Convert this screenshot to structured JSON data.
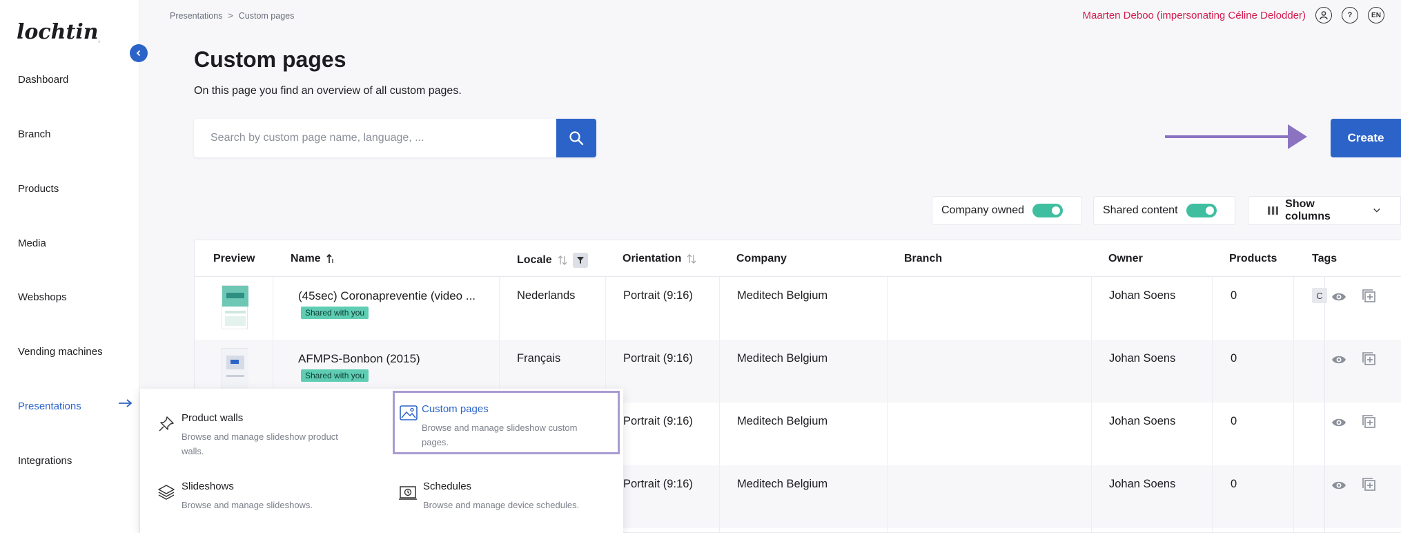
{
  "brand": {
    "logo_text": "lochting",
    "primary": "#2c63c8",
    "alert": "#d31c4c",
    "success": "#3fbfa0",
    "highlight": "#a99bd2"
  },
  "sidebar": {
    "items": [
      {
        "label": "Dashboard"
      },
      {
        "label": "Branch"
      },
      {
        "label": "Products"
      },
      {
        "label": "Media"
      },
      {
        "label": "Webshops"
      },
      {
        "label": "Vending machines"
      },
      {
        "label": "Presentations",
        "active": true
      },
      {
        "label": "Integrations"
      }
    ]
  },
  "breadcrumb": {
    "parent": "Presentations",
    "separator": ">",
    "current": "Custom pages"
  },
  "user": {
    "name": "Maarten Deboo (impersonating Céline Delodder)",
    "help_label": "?",
    "language": "EN"
  },
  "header": {
    "title": "Custom pages",
    "subtitle": "On this page you find an overview of all custom pages."
  },
  "search": {
    "placeholder": "Search by custom page name, language, ...",
    "value": ""
  },
  "actions": {
    "create_label": "Create"
  },
  "filters": {
    "company_owned": {
      "label": "Company owned",
      "on": true
    },
    "shared_content": {
      "label": "Shared content",
      "on": true
    },
    "show_columns_label": "Show columns"
  },
  "table": {
    "columns": [
      "Preview",
      "Name",
      "Locale",
      "Orientation",
      "Company",
      "Branch",
      "Owner",
      "Products",
      "Tags"
    ],
    "rows": [
      {
        "name": "(45sec) Coronapreventie (video ...",
        "badge": "Shared with you",
        "locale": "Nederlands",
        "orientation": "Portrait (9:16)",
        "company": "Meditech Belgium",
        "branch": "",
        "owner": "Johan Soens",
        "products": "0",
        "tag": "C"
      },
      {
        "name": "AFMPS-Bonbon (2015)",
        "badge": "Shared with you",
        "locale": "Français",
        "orientation": "Portrait (9:16)",
        "company": "Meditech Belgium",
        "branch": "",
        "owner": "Johan Soens",
        "products": "0",
        "tag": ""
      },
      {
        "name": "",
        "badge": "",
        "locale": "",
        "orientation": "Portrait (9:16)",
        "company": "Meditech Belgium",
        "branch": "",
        "owner": "Johan Soens",
        "products": "0",
        "tag": ""
      },
      {
        "name": "",
        "badge": "",
        "locale": "",
        "orientation": "Portrait (9:16)",
        "company": "Meditech Belgium",
        "branch": "",
        "owner": "Johan Soens",
        "products": "0",
        "tag": ""
      }
    ],
    "row_actions": [
      "eye-icon",
      "duplicate-icon"
    ]
  },
  "presentations_menu": {
    "items": [
      {
        "title": "Product walls",
        "desc": "Browse and manage slideshow product walls.",
        "icon": "pin-icon"
      },
      {
        "title": "Custom pages",
        "desc": "Browse and manage slideshow custom pages.",
        "icon": "image-icon",
        "selected": true
      },
      {
        "title": "Slideshows",
        "desc": "Browse and manage slideshows.",
        "icon": "layers-icon"
      },
      {
        "title": "Schedules",
        "desc": "Browse and manage device schedules.",
        "icon": "schedule-icon"
      }
    ]
  }
}
